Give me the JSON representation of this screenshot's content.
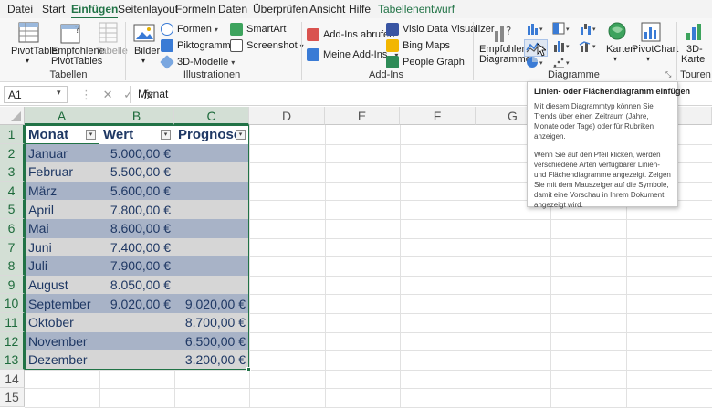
{
  "tabs": [
    {
      "label": "Datei"
    },
    {
      "label": "Start"
    },
    {
      "label": "Einfügen",
      "active": true
    },
    {
      "label": "Seitenlayout"
    },
    {
      "label": "Formeln"
    },
    {
      "label": "Daten"
    },
    {
      "label": "Überprüfen"
    },
    {
      "label": "Ansicht"
    },
    {
      "label": "Hilfe"
    },
    {
      "label": "Tabellenentwurf",
      "context": true
    }
  ],
  "ribbon": {
    "tables": {
      "label": "Tabellen",
      "pivottable": "PivotTable",
      "recommended_pivot_1": "Empfohlene",
      "recommended_pivot_2": "PivotTables",
      "table": "Tabelle"
    },
    "illustrations": {
      "label": "Illustrationen",
      "images": "Bilder",
      "shapes": "Formen",
      "icons": "Piktogramme",
      "models3d": "3D-Modelle",
      "smartart": "SmartArt",
      "screenshot": "Screenshot"
    },
    "addins": {
      "label": "Add-Ins",
      "get_addins": "Add-Ins abrufen",
      "my_addins": "Meine Add-Ins",
      "visio": "Visio Data Visualizer",
      "bing": "Bing Maps",
      "people": "People Graph"
    },
    "charts": {
      "label": "Diagramme",
      "recommended_1": "Empfohlene",
      "recommended_2": "Diagramme",
      "maps": "Karten",
      "pivotchart": "PivotChart"
    },
    "tours": {
      "label": "Touren",
      "map3d_1": "3D-",
      "map3d_2": "Karte"
    }
  },
  "formula_bar": {
    "name_box": "A1",
    "fx": "fx",
    "formula": "Monat"
  },
  "columns": [
    "A",
    "B",
    "C",
    "D",
    "E",
    "F",
    "G"
  ],
  "rows": [
    "1",
    "2",
    "3",
    "4",
    "5",
    "6",
    "7",
    "8",
    "9",
    "10",
    "11",
    "12",
    "13",
    "14",
    "15"
  ],
  "table": {
    "headers": [
      "Monat",
      "Wert",
      "Prognose"
    ],
    "data": [
      [
        "Januar",
        "5.000,00 €",
        ""
      ],
      [
        "Februar",
        "5.500,00 €",
        ""
      ],
      [
        "März",
        "5.600,00 €",
        ""
      ],
      [
        "April",
        "7.800,00 €",
        ""
      ],
      [
        "Mai",
        "8.600,00 €",
        ""
      ],
      [
        "Juni",
        "7.400,00 €",
        ""
      ],
      [
        "Juli",
        "7.900,00 €",
        ""
      ],
      [
        "August",
        "8.050,00 €",
        ""
      ],
      [
        "September",
        "9.020,00 €",
        "9.020,00 €"
      ],
      [
        "Oktober",
        "",
        "8.700,00 €"
      ],
      [
        "November",
        "",
        "6.500,00 €"
      ],
      [
        "Dezember",
        "",
        "3.200,00 €"
      ]
    ]
  },
  "tooltip": {
    "title": "Linien- oder Flächendiagramm einfügen",
    "paragraph1": "Mit diesem Diagrammtyp können Sie Trends über einen Zeitraum (Jahre, Monate oder Tage) oder für Rubriken anzeigen.",
    "paragraph2": "Wenn Sie auf den Pfeil klicken, werden verschiedene Arten verfügbarer Linien- und Flächendiagramme angezeigt. Zeigen Sie mit dem Mauszeiger auf die Symbole, damit eine Vorschau in Ihrem Dokument angezeigt wird."
  },
  "colors": {
    "accent": "#217346",
    "band_dark": "#a8b3c7",
    "band_light": "#d6d6d6",
    "text_table": "#1f3864"
  }
}
